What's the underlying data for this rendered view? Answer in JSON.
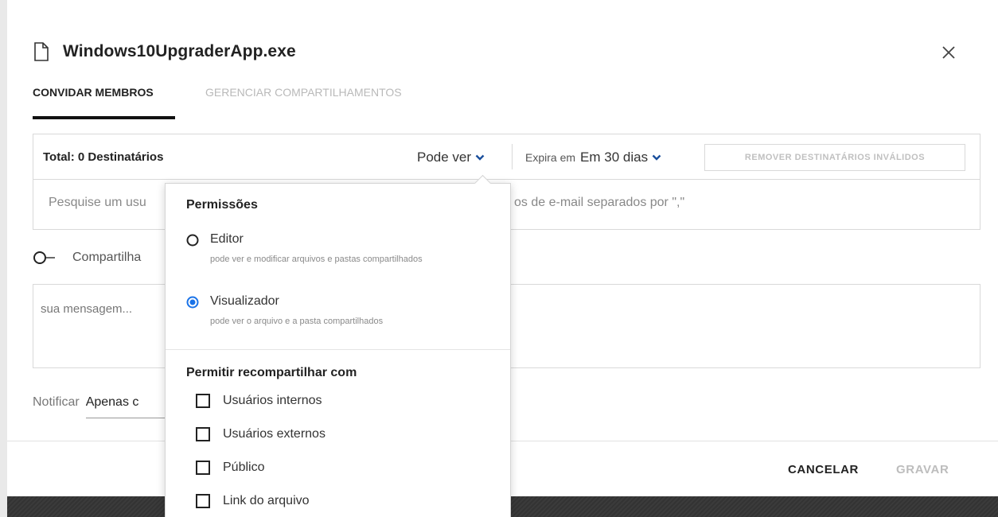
{
  "dialog": {
    "file_name": "Windows10UpgraderApp.exe",
    "tabs": [
      {
        "label": "CONVIDAR MEMBROS"
      },
      {
        "label": "GERENCIAR COMPARTILHAMENTOS"
      }
    ],
    "recipients": {
      "total_label": "Total: 0 Destinatários",
      "permission_value": "Pode ver",
      "expire_label": "Expira em",
      "expire_value": "Em 30 dias",
      "remove_invalid_label": "REMOVER DESTINATÁRIOS INVÁLIDOS"
    },
    "search": {
      "placeholder_left": "Pesquise um usu",
      "placeholder_right": "os de e-mail separados por \",\""
    },
    "share": {
      "label": "Compartilha"
    },
    "message": {
      "placeholder": "sua mensagem..."
    },
    "notify": {
      "label": "Notificar",
      "value": "Apenas c"
    },
    "footer": {
      "cancel": "CANCELAR",
      "save": "GRAVAR"
    }
  },
  "permissions_dropdown": {
    "heading": "Permissões",
    "options": [
      {
        "label": "Editor",
        "description": "pode ver e modificar arquivos e pastas compartilhados",
        "selected": false
      },
      {
        "label": "Visualizador",
        "description": "pode ver o arquivo e a pasta compartilhados",
        "selected": true
      }
    ],
    "reshare_heading": "Permitir recompartilhar com",
    "reshare_options": [
      {
        "label": "Usuários internos",
        "checked": false
      },
      {
        "label": "Usuários externos",
        "checked": false
      },
      {
        "label": "Público",
        "checked": false
      },
      {
        "label": "Link do arquivo",
        "checked": false
      }
    ]
  },
  "colors": {
    "radio_selected": "#1a73e8",
    "text_dark": "#222222",
    "disabled": "#bdbdbd"
  },
  "icons": {
    "file": "file-icon",
    "close": "close-icon",
    "chevron": "chevron-down-icon",
    "toggle": "toggle-off-icon"
  }
}
